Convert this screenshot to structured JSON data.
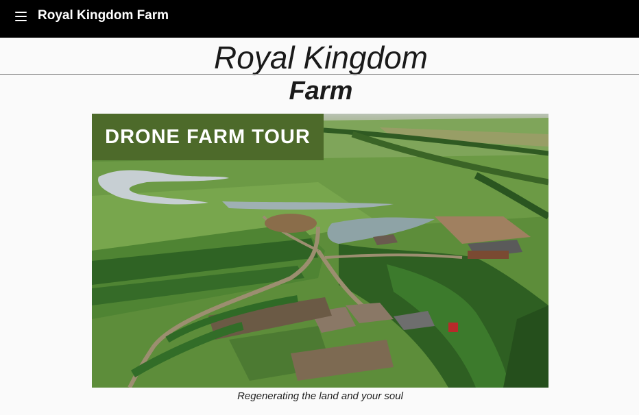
{
  "app_bar": {
    "menu_icon": "hamburger-menu-icon",
    "title": "Royal Kingdom Farm"
  },
  "page": {
    "title_line1": "Royal Kingdom",
    "title_line2": "Farm"
  },
  "hero": {
    "banner_label": "DRONE FARM TOUR",
    "caption": "Regenerating the land and your soul"
  },
  "colors": {
    "app_bar_bg": "#000000",
    "banner_bg": "#4d6a2a",
    "page_bg": "#fafafa"
  }
}
